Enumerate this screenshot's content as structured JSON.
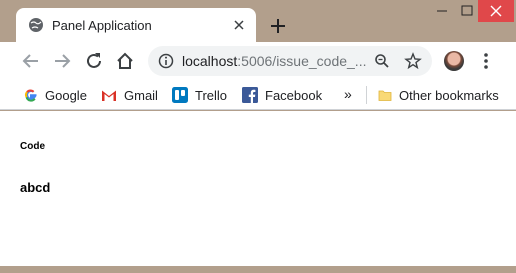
{
  "tab": {
    "title": "Panel Application",
    "favicon": "globe-icon"
  },
  "omnibox": {
    "host": "localhost",
    "path": ":5006/issue_code_..."
  },
  "bookmarks": {
    "items": [
      {
        "label": "Google",
        "icon": "google-icon"
      },
      {
        "label": "Gmail",
        "icon": "gmail-icon"
      },
      {
        "label": "Trello",
        "icon": "trello-icon"
      },
      {
        "label": "Facebook",
        "icon": "facebook-icon"
      }
    ],
    "more": "»",
    "other": "Other bookmarks"
  },
  "content": {
    "label": "Code",
    "value": "abcd"
  },
  "colors": {
    "frame": "#b29f8c",
    "close": "#e0484a",
    "omnibox": "#f1f3f4"
  }
}
